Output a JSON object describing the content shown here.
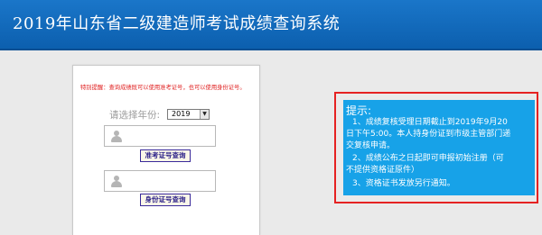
{
  "header": {
    "title": "2019年山东省二级建造师考试成绩查询系统"
  },
  "form": {
    "notice": "特别提醒：查询成绩既可以使用准考证号，也可以使用身份证号。",
    "year_label": "请选择年份:",
    "year_selected": "2019",
    "admission_button": "准考证号查询",
    "id_button": "身份证号查询"
  },
  "tips": {
    "title": "提示:",
    "lines": [
      "1、成绩复核受理日期截止到2019年9月20",
      "日下午5:00。本人持身份证到市级主管部门递",
      "交复核申请。",
      "2、成绩公布之日起即可申报初始注册（可",
      "不提供资格证原件）",
      "3、资格证书发放另行通知。"
    ]
  },
  "colors": {
    "header_bg": "#0c5fae",
    "tip_bg": "#17a2e8",
    "tip_border": "#e52222",
    "notice_text": "#e02020",
    "button_text": "#2a1f88"
  },
  "icons": {
    "field_icon": "user-icon",
    "select_arrow": "chevron-down-icon"
  }
}
